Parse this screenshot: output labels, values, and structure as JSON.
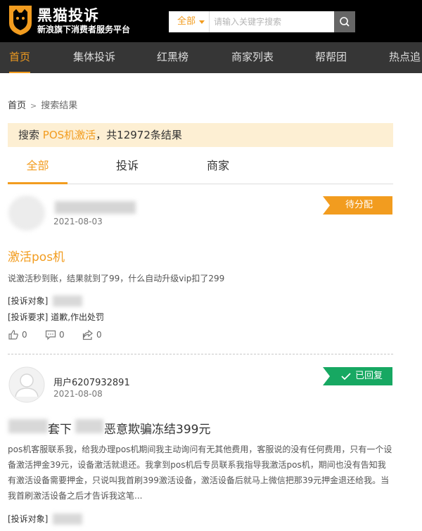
{
  "header": {
    "logo_title": "黑猫投诉",
    "logo_subtitle": "新浪旗下消费者服务平台",
    "search_scope": "全部",
    "search_placeholder": "请输入关键字搜索"
  },
  "nav": [
    "首页",
    "集体投诉",
    "红黑榜",
    "商家列表",
    "帮帮团",
    "热点追"
  ],
  "breadcrumb": {
    "home": "首页",
    "sep": ">",
    "current": "搜索结果"
  },
  "result": {
    "prefix": "搜索 ",
    "keyword": "POS机激活",
    "suffix": "，共12972条结果"
  },
  "tabs": [
    "全部",
    "投诉",
    "商家"
  ],
  "cards": [
    {
      "date": "2021-08-03",
      "status": "待分配",
      "title": "激活pos机",
      "body": "说激活秒到账，结果就到了99，什么自动升级vip扣了299",
      "target_label": "[投诉对象]",
      "request_label": "[投诉要求]",
      "request_value": "道歉,作出处罚",
      "likes": "0",
      "comments": "0",
      "shares": "0"
    },
    {
      "username": "用户6207932891",
      "date": "2021-08-08",
      "status": "已回复",
      "title_parts": [
        "套下",
        "恶意欺骗冻结399元"
      ],
      "body": "pos机客服联系我，给我办理pos机期间我主动询问有无其他费用，客服说的没有任何费用，只有一个设备激活押金39元，设备激活就退还。我拿到pos机后专员联系我指导我激活pos机，期间也没有告知我有激活设备需要押金，只说叫我首刷399激活设备，激活设备后就马上微信把那39元押金退还给我。当我首刷激活设备之后才告诉我这笔...",
      "target_label": "[投诉对象]"
    }
  ],
  "colors": {
    "accent": "#f29c1f",
    "success": "#17a862",
    "nav_bg": "#363636",
    "header_bg": "#000000"
  }
}
